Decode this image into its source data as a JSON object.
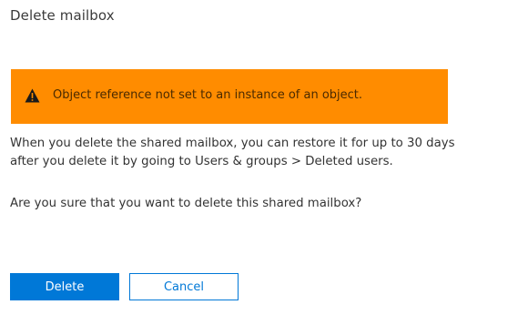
{
  "dialog": {
    "title": "Delete mailbox"
  },
  "error_banner": {
    "icon": "warning-icon",
    "message": "Object reference not set to an instance of an object.",
    "background_color": "#ff8c00"
  },
  "body": {
    "info": "When you delete the shared mailbox, you can restore it for up to 30 days after you delete it by going to Users & groups > Deleted users.",
    "confirm": "Are you sure that you want to delete this shared mailbox?"
  },
  "buttons": {
    "delete_label": "Delete",
    "cancel_label": "Cancel",
    "accent_color": "#0078d7"
  }
}
